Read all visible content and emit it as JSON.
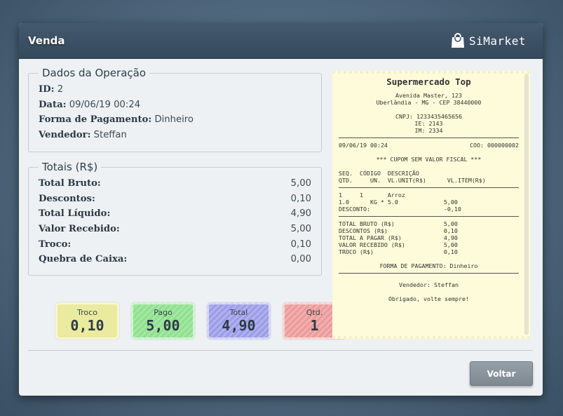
{
  "window": {
    "title": "Venda",
    "brand": "SiMarket",
    "brand_icon": "shopping-bag-icon"
  },
  "operacao": {
    "legend": "Dados da Operação",
    "id_label": "ID:",
    "id_value": "2",
    "data_label": "Data:",
    "data_value": "09/06/19 00:24",
    "pagamento_label": "Forma de Pagamento:",
    "pagamento_value": "Dinheiro",
    "vendedor_label": "Vendedor:",
    "vendedor_value": "Steffan"
  },
  "totais": {
    "legend": "Totais (R$)",
    "rows": [
      {
        "label": "Total Bruto:",
        "value": "5,00"
      },
      {
        "label": "Descontos:",
        "value": "0,10"
      },
      {
        "label": "Total Líquido:",
        "value": "4,90"
      },
      {
        "label": "Valor Recebido:",
        "value": "5,00"
      },
      {
        "label": "Troco:",
        "value": "0,10"
      },
      {
        "label": "Quebra de Caixa:",
        "value": "0,00"
      }
    ]
  },
  "tiles": [
    {
      "label": "Troco",
      "value": "0,10",
      "color": "#ebeb9f"
    },
    {
      "label": "Pago",
      "value": "5,00",
      "color": "#8fe08f"
    },
    {
      "label": "Total",
      "value": "4,90",
      "color": "#9c9ce6"
    },
    {
      "label": "Qtd.",
      "value": "1",
      "color": "#ec9a9a"
    }
  ],
  "receipt": {
    "store": "Supermercado Top",
    "address1": "Avenida Master, 123",
    "address2": "Uberlândia - MG - CEP 38440000",
    "cnpj": "CNPJ: 1233435465656",
    "ie": "IE: 2143",
    "im": "IM: 2334",
    "date": "09/06/19 00:24",
    "coo": "COO: 000000002",
    "cupom": "*** CUPOM SEM VALOR FISCAL ***",
    "header1": "SEQ.  CÓDIGO  DESCRIÇÃO",
    "header2": "QTD.     UN.  VL.UNIT(R$)      VL.ITEM(R$)",
    "item1": "1     1       Arroz",
    "item2": "1.0      KG * 5.0             5,00",
    "item3": "DESCONTO:                     -0,10",
    "tot1": "TOTAL BRUTO (R$)              5,00",
    "tot2": "DESCONTOS (R$)                0,10",
    "tot3": "TOTAL A PAGAR (R$)            4,90",
    "tot4": "VALOR RECEBIDO (R$)           5,00",
    "tot5": "TROCO (R$)                    0,10",
    "pagamento": "FORMA DE PAGAMENTO: Dinheiro",
    "vendedor": "Vendedor: Steffan",
    "obrigado": "Obrigado, volte sempre!"
  },
  "actions": {
    "voltar": "Voltar"
  }
}
